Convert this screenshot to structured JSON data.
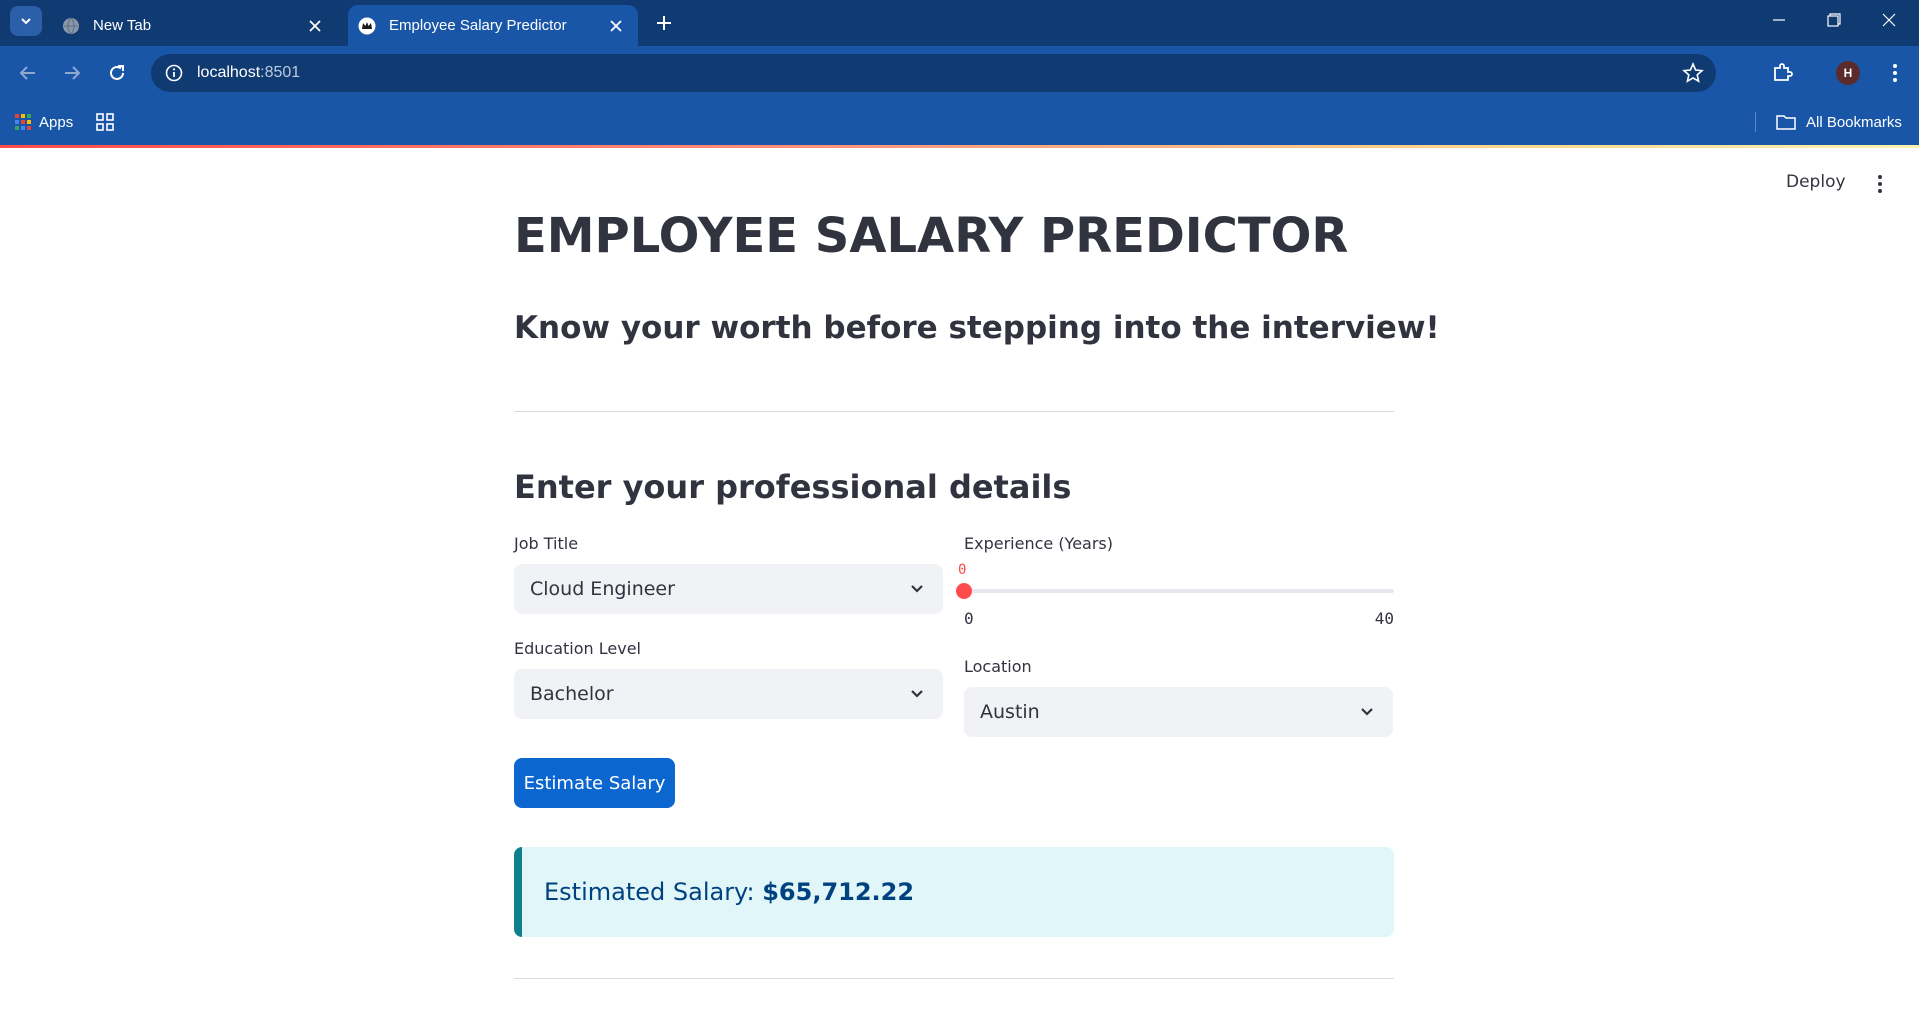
{
  "browser": {
    "tabs": [
      {
        "title": "New Tab"
      },
      {
        "title": "Employee Salary Predictor"
      }
    ],
    "url_host": "localhost",
    "url_port": ":8501",
    "bookmarks": {
      "apps": "Apps",
      "all_bookmarks": "All Bookmarks"
    },
    "profile_initial": "H"
  },
  "app": {
    "deploy_label": "Deploy",
    "title": "EMPLOYEE SALARY PREDICTOR",
    "subtitle": "Know your worth before stepping into the interview!",
    "section_heading": "Enter your professional details",
    "job_title": {
      "label": "Job Title",
      "value": "Cloud Engineer"
    },
    "experience": {
      "label": "Experience (Years)",
      "value": "0",
      "min": "0",
      "max": "40"
    },
    "education": {
      "label": "Education Level",
      "value": "Bachelor"
    },
    "location": {
      "label": "Location",
      "value": "Austin"
    },
    "estimate_button": "Estimate Salary",
    "result": {
      "prefix": "Estimated Salary: ",
      "amount": "$65,712.22"
    }
  },
  "colors": {
    "chrome_dark": "#0f3a72",
    "chrome": "#1a56a8",
    "accent_red": "#ff4b4b",
    "primary_button": "#0b66d0",
    "result_bg": "#e0f6f8"
  },
  "icons": [
    "tab-search-icon",
    "globe-icon",
    "streamlit-crown-icon",
    "close-icon",
    "plus-icon",
    "minimize-icon",
    "restore-icon",
    "window-close-icon",
    "back-icon",
    "forward-icon",
    "reload-icon",
    "info-icon",
    "star-icon",
    "extensions-icon",
    "menu-dots-icon",
    "apps-grid-icon",
    "tab-groups-icon",
    "folder-icon",
    "chevron-down-icon"
  ]
}
